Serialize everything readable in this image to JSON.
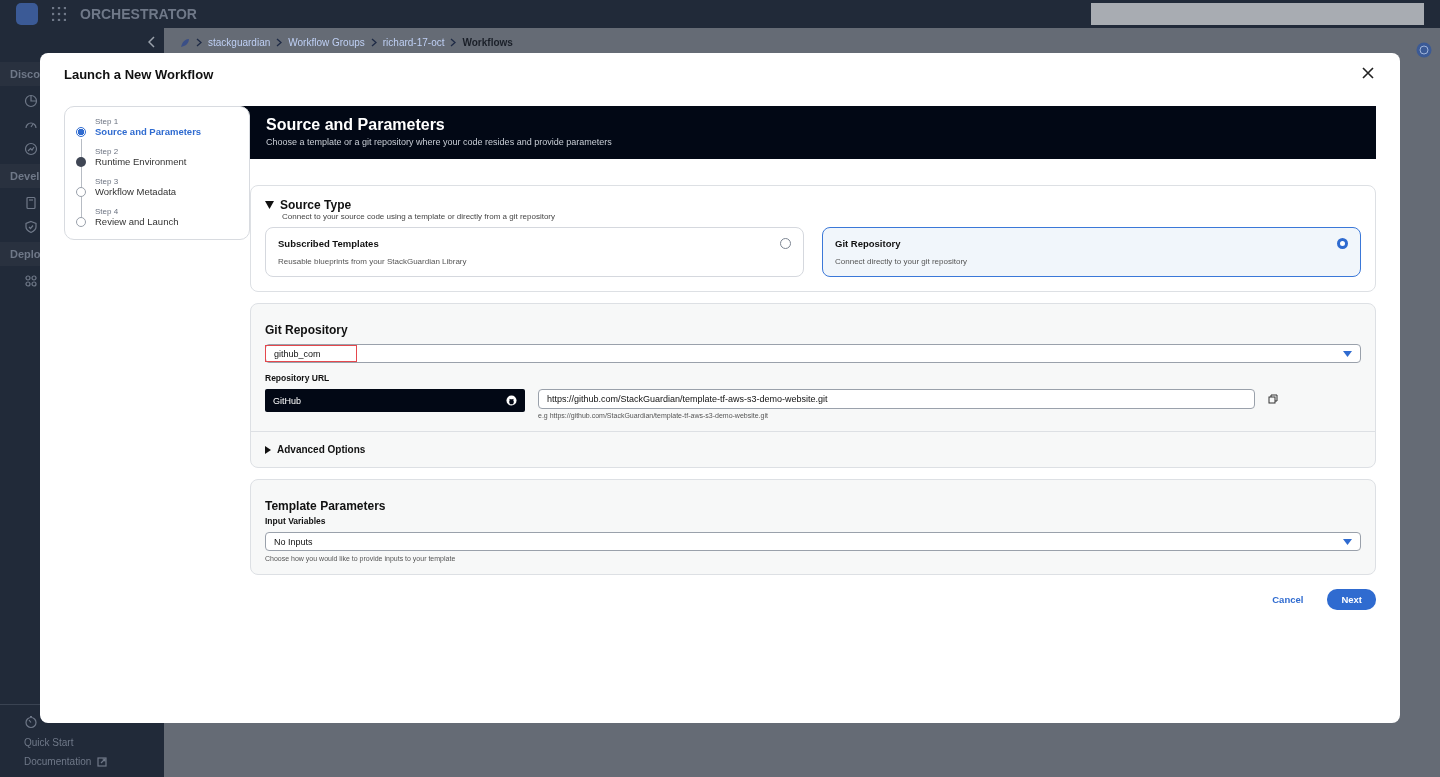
{
  "app": {
    "title": "ORCHESTRATOR"
  },
  "sidebar": {
    "sections": [
      "Disco",
      "Devel",
      "Deplo"
    ],
    "footer_links": [
      "Quick Start",
      "Documentation"
    ]
  },
  "breadcrumb": [
    {
      "label": "stackguardian",
      "current": false
    },
    {
      "label": "Workflow Groups",
      "current": false
    },
    {
      "label": "richard-17-oct",
      "current": false
    },
    {
      "label": "Workflows",
      "current": true
    }
  ],
  "dialog": {
    "title": "Launch a New Workflow",
    "steps": [
      {
        "step": "Step 1",
        "label": "Source and Parameters",
        "selected": true,
        "completed": false
      },
      {
        "step": "Step 2",
        "label": "Runtime Environment",
        "selected": false,
        "completed": true
      },
      {
        "step": "Step 3",
        "label": "Workflow Metadata",
        "selected": false,
        "completed": false
      },
      {
        "step": "Step 4",
        "label": "Review and Launch",
        "selected": false,
        "completed": false
      }
    ],
    "header": {
      "title": "Source and Parameters",
      "subtitle": "Choose a template or a git repository where your code resides and provide parameters"
    },
    "source_type": {
      "title": "Source Type",
      "expanded": true,
      "description": "Connect to your source code using a template or directly from a git repository",
      "options": [
        {
          "title": "Subscribed Templates",
          "description": "Reusable blueprints from your StackGuardian Library",
          "selected": false
        },
        {
          "title": "Git Repository",
          "description": "Connect directly to your git repository",
          "selected": true
        }
      ]
    },
    "git_repository": {
      "title": "Git Repository",
      "value": "github_com",
      "url_label": "Repository URL",
      "provider": "GitHub",
      "url": "https://github.com/StackGuardian/template-tf-aws-s3-demo-website.git",
      "hint": "e.g https://github.com/StackGuardian/template-tf-aws-s3-demo-website.git",
      "advanced": {
        "label": "Advanced Options",
        "expanded": false
      }
    },
    "template_parameters": {
      "title": "Template Parameters",
      "input_label": "Input Variables",
      "value": "No Inputs",
      "hint": "Choose how you would like to provide inputs to your template"
    },
    "buttons": {
      "cancel": "Cancel",
      "next": "Next"
    }
  }
}
